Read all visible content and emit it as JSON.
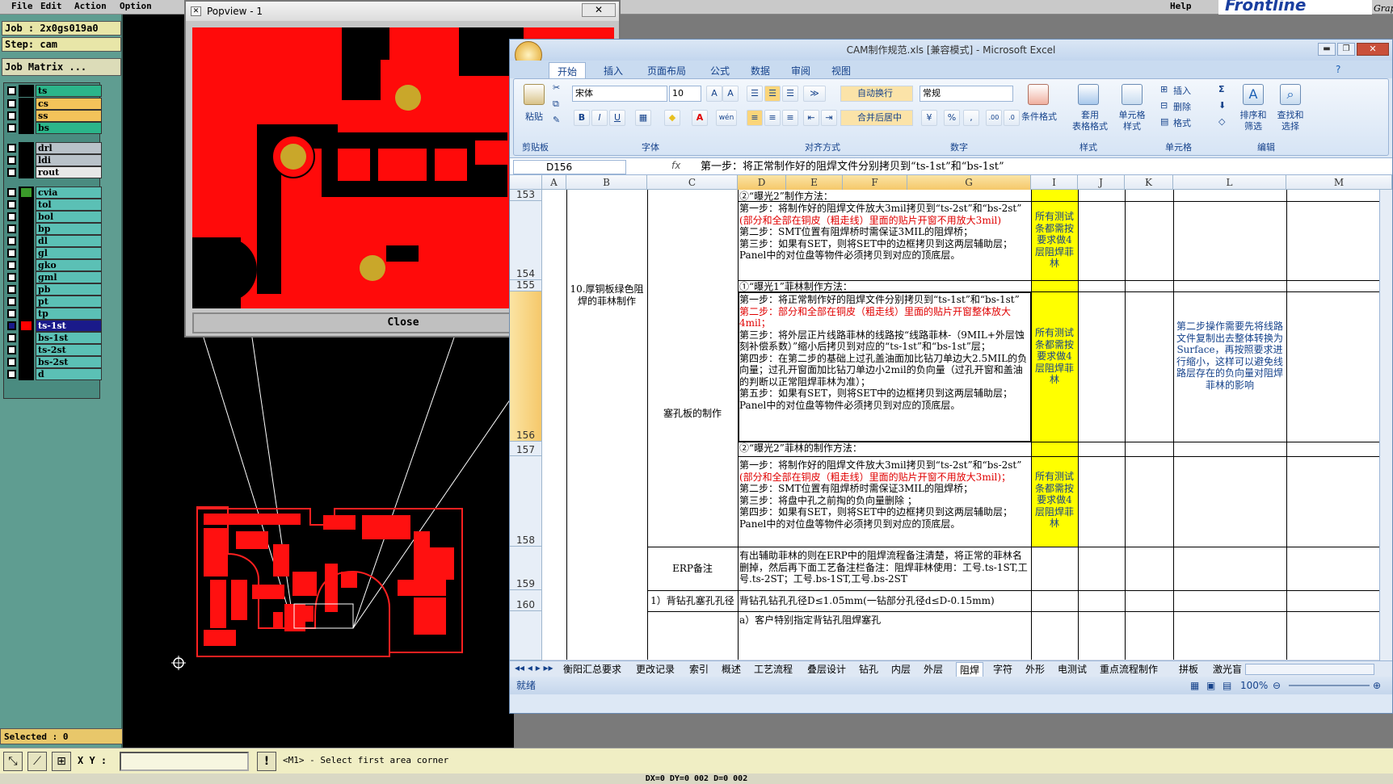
{
  "cam": {
    "menu": [
      "File",
      "Edit",
      "Action",
      "Option",
      "Help"
    ],
    "job_label": "Job : 2x0gs019a0",
    "step_label": "Step: cam",
    "job_matrix": "Job Matrix ...",
    "selected": "Selected : 0",
    "xy_label": "X Y :",
    "xy_value": "",
    "prompt": "<M1> - Select first area corner",
    "bottom_info": "DX=0 DY=0 002 D=0 002",
    "layers": [
      {
        "name": "ts",
        "bg": "#2bb58a",
        "sel": false
      },
      {
        "name": "cs",
        "bg": "#f3c35a",
        "sel": false
      },
      {
        "name": "ss",
        "bg": "#f3c35a",
        "sel": false
      },
      {
        "name": "bs",
        "bg": "#2bb58a",
        "sel": false
      },
      {
        "name": "drl",
        "bg": "#b9c2c9",
        "sel": false
      },
      {
        "name": "ldi",
        "bg": "#b9c2c9",
        "sel": false
      },
      {
        "name": "rout",
        "bg": "#e8e8e8",
        "sel": false
      },
      {
        "name": "cvia",
        "bg": "#5bc0b5",
        "sel": false,
        "color": "#3a9a2a"
      },
      {
        "name": "tol",
        "bg": "#5bc0b5",
        "sel": false
      },
      {
        "name": "bol",
        "bg": "#5bc0b5",
        "sel": false
      },
      {
        "name": "bp",
        "bg": "#5bc0b5",
        "sel": false
      },
      {
        "name": "dl",
        "bg": "#5bc0b5",
        "sel": false
      },
      {
        "name": "gl",
        "bg": "#5bc0b5",
        "sel": false
      },
      {
        "name": "gko",
        "bg": "#5bc0b5",
        "sel": false
      },
      {
        "name": "gml",
        "bg": "#5bc0b5",
        "sel": false
      },
      {
        "name": "pb",
        "bg": "#5bc0b5",
        "sel": false
      },
      {
        "name": "pt",
        "bg": "#5bc0b5",
        "sel": false
      },
      {
        "name": "tp",
        "bg": "#5bc0b5",
        "sel": false
      },
      {
        "name": "ts-1st",
        "bg": "#5bc0b5",
        "sel": true,
        "color": "#ff0000"
      },
      {
        "name": "bs-1st",
        "bg": "#5bc0b5",
        "sel": false
      },
      {
        "name": "ts-2st",
        "bg": "#5bc0b5",
        "sel": false
      },
      {
        "name": "bs-2st",
        "bg": "#5bc0b5",
        "sel": false
      },
      {
        "name": "d",
        "bg": "#5bc0b5",
        "sel": false
      }
    ],
    "logo": "Frontline",
    "logo_partial": "Grap"
  },
  "popview": {
    "title": "Popview - 1",
    "close_x": "✕",
    "close_button": "Close"
  },
  "excel": {
    "title": "CAM制作规范.xls [兼容模式] - Microsoft Excel",
    "tabs": [
      "开始",
      "插入",
      "页面布局",
      "公式",
      "数据",
      "审阅",
      "视图"
    ],
    "ribbon": {
      "paste": "粘贴",
      "clipboard": "剪贴板",
      "font_name": "宋体",
      "font_size": "10",
      "font_group": "字体",
      "wrap": "自动换行",
      "merge": "合并后居中",
      "align_group": "对齐方式",
      "number_format": "常规",
      "number_group": "数字",
      "cond_format": "条件格式",
      "table_format": "套用\n表格格式",
      "cell_style": "单元格\n样式",
      "style_group": "样式",
      "insert": "插入",
      "delete": "删除",
      "format": "格式",
      "cells_group": "单元格",
      "sort": "排序和\n筛选",
      "find": "查找和\n选择",
      "edit_group": "编辑"
    },
    "namebox": "D156",
    "fx": "fx",
    "formula": "第一步：将正常制作好的阻焊文件分别拷贝到“ts-1st”和“bs-1st”",
    "columns": [
      "A",
      "B",
      "C",
      "D",
      "E",
      "F",
      "G",
      "I",
      "J",
      "K",
      "L",
      "M"
    ],
    "rows": {
      "r153": "153",
      "r154": "154",
      "r155": "155",
      "r156": "156",
      "r157": "157",
      "r158": "158",
      "r159": "159",
      "r160": "160"
    },
    "cells": {
      "d153": "②“曝光2”制作方法：",
      "d154_1": "第一步：将制作好的阻焊文件放大3mil拷贝到“ts-2st”和“bs-2st”",
      "d154_2": "(部分和全部在铜皮（粗走线）里面的贴片开窗不用放大3mil)",
      "d154_3": "第二步：SMT位置有阻焊桥时需保证3MIL的阻焊桥；",
      "d154_4": "第三步：如果有SET，则将SET中的边框拷贝到这两层辅助层；",
      "d154_5": "Panel中的对位盘等物件必须拷贝到对应的顶底层。",
      "i154": "所有测试条都需按要求做4层阻焊菲林",
      "b155": "10.厚铜板绿色阻焊的菲林制作",
      "c156": "塞孔板的制作",
      "d155": "①“曝光1”菲林制作方法：",
      "d156_1": "第一步：将正常制作好的阻焊文件分别拷贝到“ts-1st”和“bs-1st”",
      "d156_2": "第二步：部分和全部在铜皮（粗走线）里面的贴片开窗整体放大4mil；",
      "d156_3": "第三步：将外层正片线路菲林的线路按“线路菲林-（9MIL+外层蚀刻补偿系数）”缩小后拷贝到对应的“ts-1st”和“bs-1st”层；",
      "d156_4": "第四步：在第二步的基础上过孔盖油面加比钻刀单边大2.5MIL的负向量；过孔开窗面加比钻刀单边小2mil的负向量（过孔开窗和盖油的判断以正常阻焊菲林为准）；",
      "d156_5": "第五步：如果有SET，则将SET中的边框拷贝到这两层辅助层；",
      "d156_6": "Panel中的对位盘等物件必须拷贝到对应的顶底层。",
      "i156": "所有测试条都需按要求做4层阻焊菲林",
      "l156": "第二步操作需要先将线路文件复制出去整体转换为Surface，再按照要求进行缩小，这样可以避免线路层存在的负向量对阻焊菲林的影响",
      "d157": "②“曝光2”菲林的制作方法：",
      "d158_1": "第一步：将制作好的阻焊文件放大3mil拷贝到“ts-2st”和“bs-2st”",
      "d158_2": "(部分和全部在铜皮（粗走线）里面的贴片开窗不用放大3mil)；",
      "d158_3": "第二步：SMT位置有阻焊桥时需保证3MIL的阻焊桥；",
      "d158_4": "第三步：将盘中孔之前掏的负向量删除 ；",
      "d158_5": "第四步：如果有SET，则将SET中的边框拷贝到这两层辅助层；",
      "d158_6": "Panel中的对位盘等物件必须拷贝到对应的顶底层。",
      "i158": "所有测试条都需按要求做4层阻焊菲林",
      "c159": "ERP备注",
      "d159": "有出辅助菲林的则在ERP中的阻焊流程备注清楚，将正常的菲林名删掉，然后再下面工艺备注栏备注：阻焊菲林使用：工号.ts-1ST,工号.ts-2ST；工号.bs-1ST,工号.bs-2ST",
      "c160": "1）背钻孔塞孔孔径",
      "d160": "背钻孔钻孔孔径D≤1.05mm(一钻部分孔径d≤D-0.15mm)",
      "d161": "a）客户特别指定背钻孔阻焊塞孔"
    },
    "sheet_tabs": [
      "衡阳汇总要求",
      "更改记录",
      "索引",
      "概述",
      "工艺流程",
      "叠层设计",
      "钻孔",
      "内层",
      "外层",
      "阻焊",
      "字符",
      "外形",
      "电测试",
      "重点流程制作",
      "拼板",
      "激光盲"
    ],
    "active_sheet": "阻焊",
    "status": "就绪",
    "zoom": "100%"
  }
}
